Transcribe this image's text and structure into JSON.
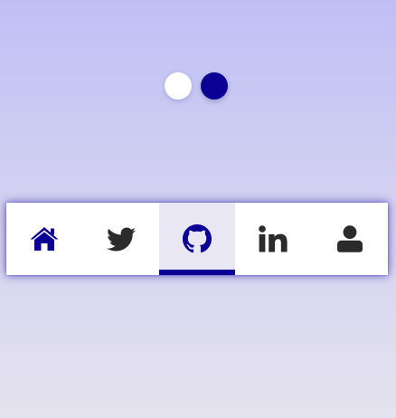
{
  "colors": {
    "accent": "#0b0094",
    "icon_default": "#2b2b2b",
    "active_bg": "#e8e7f3",
    "toggle_light": "#ffffff",
    "toggle_dark": "#0b0094"
  },
  "theme_toggle": {
    "options": [
      {
        "name": "light",
        "color": "#ffffff"
      },
      {
        "name": "dark",
        "color": "#0b0094"
      }
    ]
  },
  "nav": {
    "active_index": 2,
    "items": [
      {
        "icon": "home-icon",
        "color": "#0b0094"
      },
      {
        "icon": "twitter-icon",
        "color": "#2b2b2b"
      },
      {
        "icon": "github-icon",
        "color": "#0b0094"
      },
      {
        "icon": "linkedin-icon",
        "color": "#2b2b2b"
      },
      {
        "icon": "user-icon",
        "color": "#2b2b2b"
      }
    ]
  }
}
